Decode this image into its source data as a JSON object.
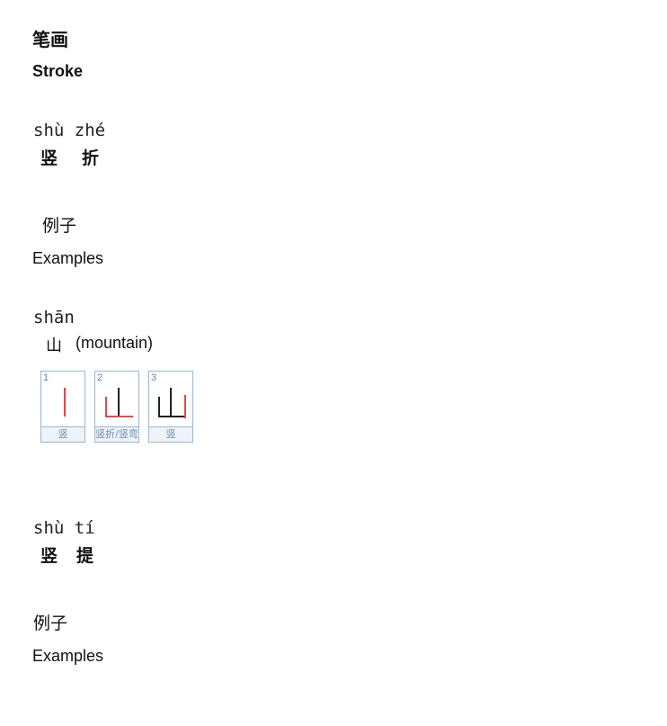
{
  "section1": {
    "heading_cn": "笔画",
    "heading_en": "Stroke"
  },
  "stroke1": {
    "pinyin": "shù zhé",
    "chars": [
      "竖",
      "折"
    ]
  },
  "examples1": {
    "heading_cn": "例子",
    "heading_en": "Examples",
    "pinyin": "shān",
    "character": "山",
    "meaning": "(mountain)",
    "stroke_order": [
      {
        "number": "1",
        "label": "竖"
      },
      {
        "number": "2",
        "label": "竖折/竖弯"
      },
      {
        "number": "3",
        "label": "竖"
      }
    ]
  },
  "stroke2": {
    "pinyin": "shù tí",
    "chars": [
      "竖",
      "提"
    ]
  },
  "examples2": {
    "heading_cn": "例子",
    "heading_en": "Examples"
  },
  "colors": {
    "highlight_stroke": "#e8454b",
    "previous_stroke": "#222222",
    "card_border": "#9db5d2"
  }
}
